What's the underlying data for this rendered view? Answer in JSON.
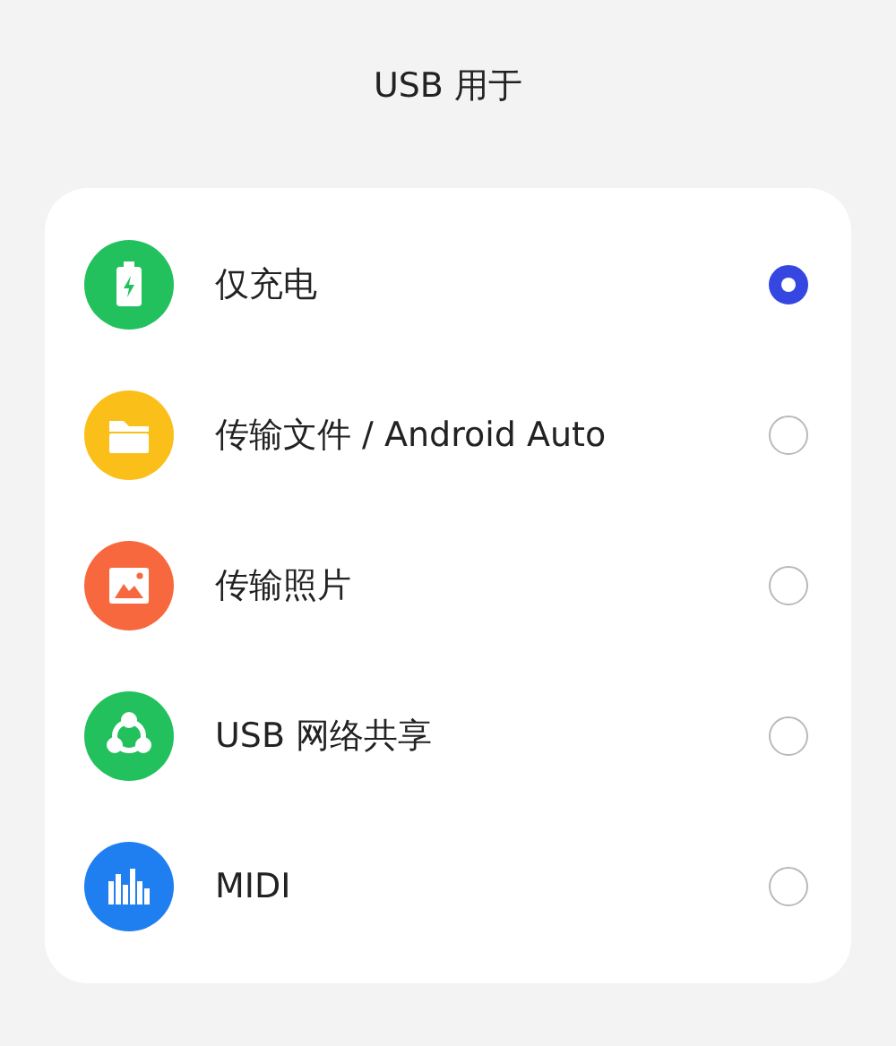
{
  "title": "USB 用于",
  "options": [
    {
      "label": "仅充电",
      "selected": true,
      "kind": "battery",
      "color": "#22c15e"
    },
    {
      "label": "传输文件 / Android Auto",
      "selected": false,
      "kind": "folder",
      "color": "#fbbf1a"
    },
    {
      "label": "传输照片",
      "selected": false,
      "kind": "photo",
      "color": "#f8683f"
    },
    {
      "label": "USB 网络共享",
      "selected": false,
      "kind": "share",
      "color": "#22c15e"
    },
    {
      "label": "MIDI",
      "selected": false,
      "kind": "midi",
      "color": "#1f7ff0"
    }
  ]
}
